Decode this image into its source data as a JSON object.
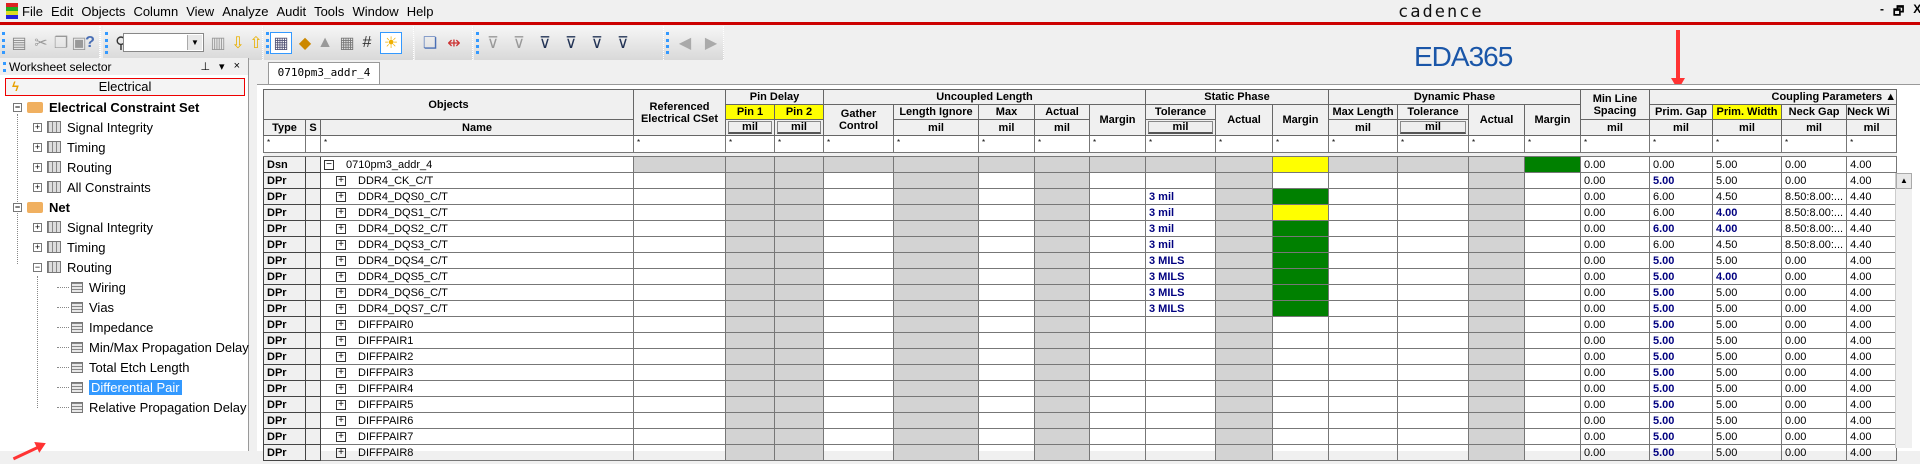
{
  "menu": [
    "File",
    "Edit",
    "Objects",
    "Column",
    "View",
    "Analyze",
    "Audit",
    "Tools",
    "Window",
    "Help"
  ],
  "branding": {
    "logo": "cadence",
    "watermark": "EDA365"
  },
  "window_controls": {
    "minimize": "-",
    "restore": "🗗",
    "close": "X"
  },
  "toolbar": {
    "combo_value": "",
    "icons": [
      "print-icon",
      "cut-icon",
      "copy-icon",
      "paste-icon",
      "help-icon",
      "binoculars-icon",
      "combo",
      "filter-object-icon",
      "bookmark-down-icon",
      "bookmark-up-icon",
      "worksheet-icon",
      "cset-icon",
      "lock-icon",
      "grid-icon",
      "number-icon",
      "sun-icon",
      "report-icon",
      "diffpair-icon",
      "filter-1-icon",
      "filter-2-icon",
      "filter-3-icon",
      "filter-4-icon",
      "filter-5-icon",
      "filter-6-icon",
      "back-icon",
      "forward-icon"
    ]
  },
  "worksheet_selector": {
    "title": "Worksheet selector",
    "pin": "⊥",
    "dropdown": "▾",
    "close": "×",
    "category": "Electrical",
    "tree": [
      {
        "label": "Electrical Constraint Set",
        "level": 0,
        "expander": "−",
        "kind": "folder"
      },
      {
        "label": "Signal Integrity",
        "level": 1,
        "expander": "+",
        "kind": "grid"
      },
      {
        "label": "Timing",
        "level": 1,
        "expander": "+",
        "kind": "grid"
      },
      {
        "label": "Routing",
        "level": 1,
        "expander": "+",
        "kind": "grid"
      },
      {
        "label": "All Constraints",
        "level": 1,
        "expander": "+",
        "kind": "grid"
      },
      {
        "label": "Net",
        "level": 0,
        "expander": "−",
        "kind": "folder"
      },
      {
        "label": "Signal Integrity",
        "level": 1,
        "expander": "+",
        "kind": "grid"
      },
      {
        "label": "Timing",
        "level": 1,
        "expander": "+",
        "kind": "grid"
      },
      {
        "label": "Routing",
        "level": 1,
        "expander": "−",
        "kind": "grid"
      },
      {
        "label": "Wiring",
        "level": 2,
        "kind": "sheet"
      },
      {
        "label": "Vias",
        "level": 2,
        "kind": "sheet"
      },
      {
        "label": "Impedance",
        "level": 2,
        "kind": "sheet"
      },
      {
        "label": "Min/Max Propagation Delay",
        "level": 2,
        "kind": "sheet"
      },
      {
        "label": "Total Etch Length",
        "level": 2,
        "kind": "sheet"
      },
      {
        "label": "Differential Pair",
        "level": 2,
        "kind": "sheet",
        "selected": true
      },
      {
        "label": "Relative Propagation Delay",
        "level": 2,
        "kind": "sheet"
      }
    ]
  },
  "tab": "0710pm3_addr_4",
  "grid": {
    "groups": {
      "objects": "Objects",
      "ref_cset": "Referenced Electrical CSet",
      "pin_delay": "Pin Delay",
      "uncoupled": "Uncoupled Length",
      "static": "Static Phase",
      "dynamic": "Dynamic Phase",
      "min_line": "Min Line Spacing",
      "coupling": "Coupling Parameters"
    },
    "cols": {
      "type": "Type",
      "s": "S",
      "name": "Name",
      "pin1": "Pin 1",
      "pin2": "Pin 2",
      "gather": "Gather Control",
      "len_ignore": "Length Ignore",
      "max": "Max",
      "actual": "Actual",
      "margin": "Margin",
      "tolerance": "Tolerance",
      "max_length": "Max Length",
      "prim_gap": "Prim. Gap",
      "prim_width": "Prim. Width",
      "neck_gap": "Neck Gap",
      "neck_width": "Neck Wi"
    },
    "unit": "mil",
    "filter": "*",
    "rows": [
      {
        "type": "Dsn",
        "expander": "−",
        "name": "0710pm3_addr_4",
        "tolerance": "",
        "static_margin": "yellow",
        "min_line": "0.00",
        "prim_gap": "0.00",
        "prim_gap_bold": false,
        "prim_width": "5.00",
        "prim_width_bold": false,
        "neck_gap": "0.00",
        "neck_width": "4.00",
        "design": true
      },
      {
        "type": "DPr",
        "expander": "+",
        "name": "DDR4_CK_C/T",
        "tolerance": "",
        "static_margin": "none",
        "min_line": "0.00",
        "prim_gap": "5.00",
        "prim_gap_bold": true,
        "prim_width": "5.00",
        "prim_width_bold": false,
        "neck_gap": "0.00",
        "neck_width": "4.00"
      },
      {
        "type": "DPr",
        "expander": "+",
        "name": "DDR4_DQS0_C/T",
        "tolerance": "3 mil",
        "static_margin": "green",
        "min_line": "0.00",
        "prim_gap": "6.00",
        "prim_gap_bold": false,
        "prim_width": "4.50",
        "prim_width_bold": false,
        "neck_gap": "8.50:8.00:...",
        "neck_width": "4.40"
      },
      {
        "type": "DPr",
        "expander": "+",
        "name": "DDR4_DQS1_C/T",
        "tolerance": "3 mil",
        "static_margin": "yellow",
        "min_line": "0.00",
        "prim_gap": "6.00",
        "prim_gap_bold": false,
        "prim_width": "4.00",
        "prim_width_bold": true,
        "neck_gap": "8.50:8.00:...",
        "neck_width": "4.40"
      },
      {
        "type": "DPr",
        "expander": "+",
        "name": "DDR4_DQS2_C/T",
        "tolerance": "3 mil",
        "static_margin": "green",
        "min_line": "0.00",
        "prim_gap": "6.00",
        "prim_gap_bold": true,
        "prim_width": "4.00",
        "prim_width_bold": true,
        "neck_gap": "8.50:8.00:...",
        "neck_width": "4.40"
      },
      {
        "type": "DPr",
        "expander": "+",
        "name": "DDR4_DQS3_C/T",
        "tolerance": "3 mil",
        "static_margin": "green",
        "min_line": "0.00",
        "prim_gap": "6.00",
        "prim_gap_bold": false,
        "prim_width": "4.50",
        "prim_width_bold": false,
        "neck_gap": "8.50:8.00:...",
        "neck_width": "4.40"
      },
      {
        "type": "DPr",
        "expander": "+",
        "name": "DDR4_DQS4_C/T",
        "tolerance": "3 MILS",
        "static_margin": "green",
        "min_line": "0.00",
        "prim_gap": "5.00",
        "prim_gap_bold": true,
        "prim_width": "5.00",
        "prim_width_bold": false,
        "neck_gap": "0.00",
        "neck_width": "4.00"
      },
      {
        "type": "DPr",
        "expander": "+",
        "name": "DDR4_DQS5_C/T",
        "tolerance": "3 MILS",
        "static_margin": "green",
        "min_line": "0.00",
        "prim_gap": "5.00",
        "prim_gap_bold": true,
        "prim_width": "4.00",
        "prim_width_bold": true,
        "neck_gap": "0.00",
        "neck_width": "4.00"
      },
      {
        "type": "DPr",
        "expander": "+",
        "name": "DDR4_DQS6_C/T",
        "tolerance": "3 MILS",
        "static_margin": "green",
        "min_line": "0.00",
        "prim_gap": "5.00",
        "prim_gap_bold": true,
        "prim_width": "5.00",
        "prim_width_bold": false,
        "neck_gap": "0.00",
        "neck_width": "4.00"
      },
      {
        "type": "DPr",
        "expander": "+",
        "name": "DDR4_DQS7_C/T",
        "tolerance": "3 MILS",
        "static_margin": "green",
        "min_line": "0.00",
        "prim_gap": "5.00",
        "prim_gap_bold": true,
        "prim_width": "5.00",
        "prim_width_bold": false,
        "neck_gap": "0.00",
        "neck_width": "4.00"
      },
      {
        "type": "DPr",
        "expander": "+",
        "name": "DIFFPAIR0",
        "tolerance": "",
        "static_margin": "none",
        "min_line": "0.00",
        "prim_gap": "5.00",
        "prim_gap_bold": true,
        "prim_width": "5.00",
        "prim_width_bold": false,
        "neck_gap": "0.00",
        "neck_width": "4.00"
      },
      {
        "type": "DPr",
        "expander": "+",
        "name": "DIFFPAIR1",
        "tolerance": "",
        "static_margin": "none",
        "min_line": "0.00",
        "prim_gap": "5.00",
        "prim_gap_bold": true,
        "prim_width": "5.00",
        "prim_width_bold": false,
        "neck_gap": "0.00",
        "neck_width": "4.00"
      },
      {
        "type": "DPr",
        "expander": "+",
        "name": "DIFFPAIR2",
        "tolerance": "",
        "static_margin": "none",
        "min_line": "0.00",
        "prim_gap": "5.00",
        "prim_gap_bold": true,
        "prim_width": "5.00",
        "prim_width_bold": false,
        "neck_gap": "0.00",
        "neck_width": "4.00"
      },
      {
        "type": "DPr",
        "expander": "+",
        "name": "DIFFPAIR3",
        "tolerance": "",
        "static_margin": "none",
        "min_line": "0.00",
        "prim_gap": "5.00",
        "prim_gap_bold": true,
        "prim_width": "5.00",
        "prim_width_bold": false,
        "neck_gap": "0.00",
        "neck_width": "4.00"
      },
      {
        "type": "DPr",
        "expander": "+",
        "name": "DIFFPAIR4",
        "tolerance": "",
        "static_margin": "none",
        "min_line": "0.00",
        "prim_gap": "5.00",
        "prim_gap_bold": true,
        "prim_width": "5.00",
        "prim_width_bold": false,
        "neck_gap": "0.00",
        "neck_width": "4.00"
      },
      {
        "type": "DPr",
        "expander": "+",
        "name": "DIFFPAIR5",
        "tolerance": "",
        "static_margin": "none",
        "min_line": "0.00",
        "prim_gap": "5.00",
        "prim_gap_bold": true,
        "prim_width": "5.00",
        "prim_width_bold": false,
        "neck_gap": "0.00",
        "neck_width": "4.00"
      },
      {
        "type": "DPr",
        "expander": "+",
        "name": "DIFFPAIR6",
        "tolerance": "",
        "static_margin": "none",
        "min_line": "0.00",
        "prim_gap": "5.00",
        "prim_gap_bold": true,
        "prim_width": "5.00",
        "prim_width_bold": false,
        "neck_gap": "0.00",
        "neck_width": "4.00"
      },
      {
        "type": "DPr",
        "expander": "+",
        "name": "DIFFPAIR7",
        "tolerance": "",
        "static_margin": "none",
        "min_line": "0.00",
        "prim_gap": "5.00",
        "prim_gap_bold": true,
        "prim_width": "5.00",
        "prim_width_bold": false,
        "neck_gap": "0.00",
        "neck_width": "4.00"
      },
      {
        "type": "DPr",
        "expander": "+",
        "name": "DIFFPAIR8",
        "tolerance": "",
        "static_margin": "none",
        "min_line": "0.00",
        "prim_gap": "5.00",
        "prim_gap_bold": true,
        "prim_width": "5.00",
        "prim_width_bold": false,
        "neck_gap": "0.00",
        "neck_width": "4.00"
      }
    ]
  },
  "colors": {
    "accent_red": "#cc0000",
    "selection": "#3399ff",
    "margin_pass": "#008000",
    "margin_warn": "#ffff00",
    "value_blue": "#000080"
  }
}
